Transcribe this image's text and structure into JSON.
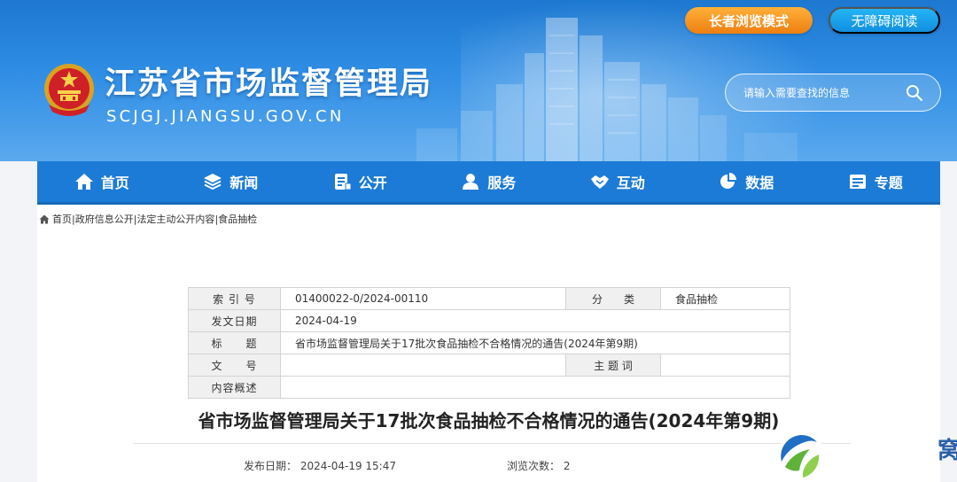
{
  "header": {
    "site_title": "江苏省市场监督管理局",
    "site_domain": "SCJGJ.JIANGSU.GOV.CN",
    "elder_mode_label": "长者浏览模式",
    "accessibility_label": "无障碍阅读",
    "search": {
      "placeholder": "请输入需要查找的信息"
    }
  },
  "nav": {
    "items": [
      {
        "label": "首页",
        "icon": "home-icon"
      },
      {
        "label": "新闻",
        "icon": "layers-icon"
      },
      {
        "label": "公开",
        "icon": "document-icon"
      },
      {
        "label": "服务",
        "icon": "user-icon"
      },
      {
        "label": "互动",
        "icon": "handshake-icon"
      },
      {
        "label": "数据",
        "icon": "pie-chart-icon"
      },
      {
        "label": "专题",
        "icon": "board-icon"
      }
    ]
  },
  "breadcrumb": {
    "items": [
      "首页",
      "政府信息公开",
      "法定主动公开内容",
      "食品抽检"
    ],
    "separator": "|"
  },
  "meta": {
    "index_label": "索 引 号",
    "index_value": "01400022-0/2024-00110",
    "category_label": "分　　类",
    "category_value": "食品抽检",
    "date_label": "发文日期",
    "date_value": "2024-04-19",
    "title_label": "标　　题",
    "title_value": "省市场监督管理局关于17批次食品抽检不合格情况的通告(2024年第9期)",
    "doc_no_label": "文　　号",
    "doc_no_value": "",
    "subject_label": "主 题 词",
    "subject_value": "",
    "summary_label": "内容概述",
    "summary_value": ""
  },
  "article": {
    "title": "省市场监督管理局关于17批次食品抽检不合格情况的通告(2024年第9期)",
    "publish_label": "发布日期：",
    "publish_value": "2024-04-19 15:47",
    "views_label": "浏览次数：",
    "views_value": "2"
  },
  "edge_char": "窝",
  "colors": {
    "header_blue": "#2f8de4",
    "nav_blue": "#1c7bd6",
    "elder_orange": "#ee7f10",
    "access_blue": "#118fe0"
  }
}
